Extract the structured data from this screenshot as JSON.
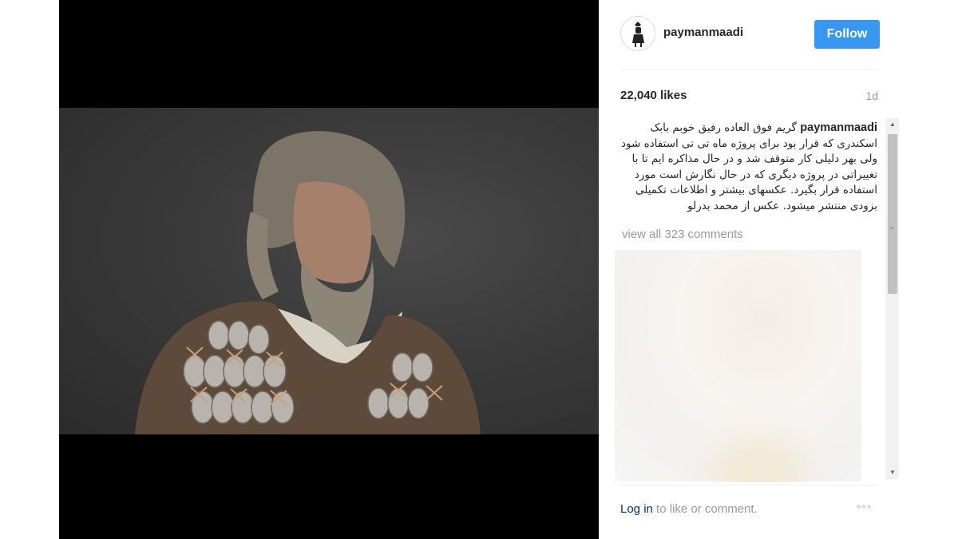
{
  "post": {
    "username": "paymanmaadi",
    "follow_label": "Follow",
    "likes": "22,040 likes",
    "time": "1d",
    "caption_user": "paymanmaadi",
    "caption_text": "گریم فوق العاده رفیق خوبم بابک اسکندری که قرار بود برای پروژه ماه تی تی استفاده شود ولی بهر دلیلی کار متوقف شد و در حال مذاکره ایم تا با تغییراتی در پروژه دیگری که در حال نگارش است مورد استفاده قرار بگیرد. عکسهای بیشتر و اطلاعات تکمیلی بزودی منتشر میشود. عکس از محمد بدرلو",
    "view_all": "view all 323 comments",
    "login_link": "Log in",
    "login_suffix": " to like or comment.",
    "more_label": "◦◦◦"
  },
  "icons": {
    "avatar": "profile-avatar-icon",
    "more": "more-options-icon",
    "scroll_up": "scroll-up-arrow-icon",
    "scroll_down": "scroll-down-arrow-icon"
  },
  "colors": {
    "accent": "#3897f0",
    "link": "#003569",
    "muted": "#999999",
    "text": "#262626"
  }
}
